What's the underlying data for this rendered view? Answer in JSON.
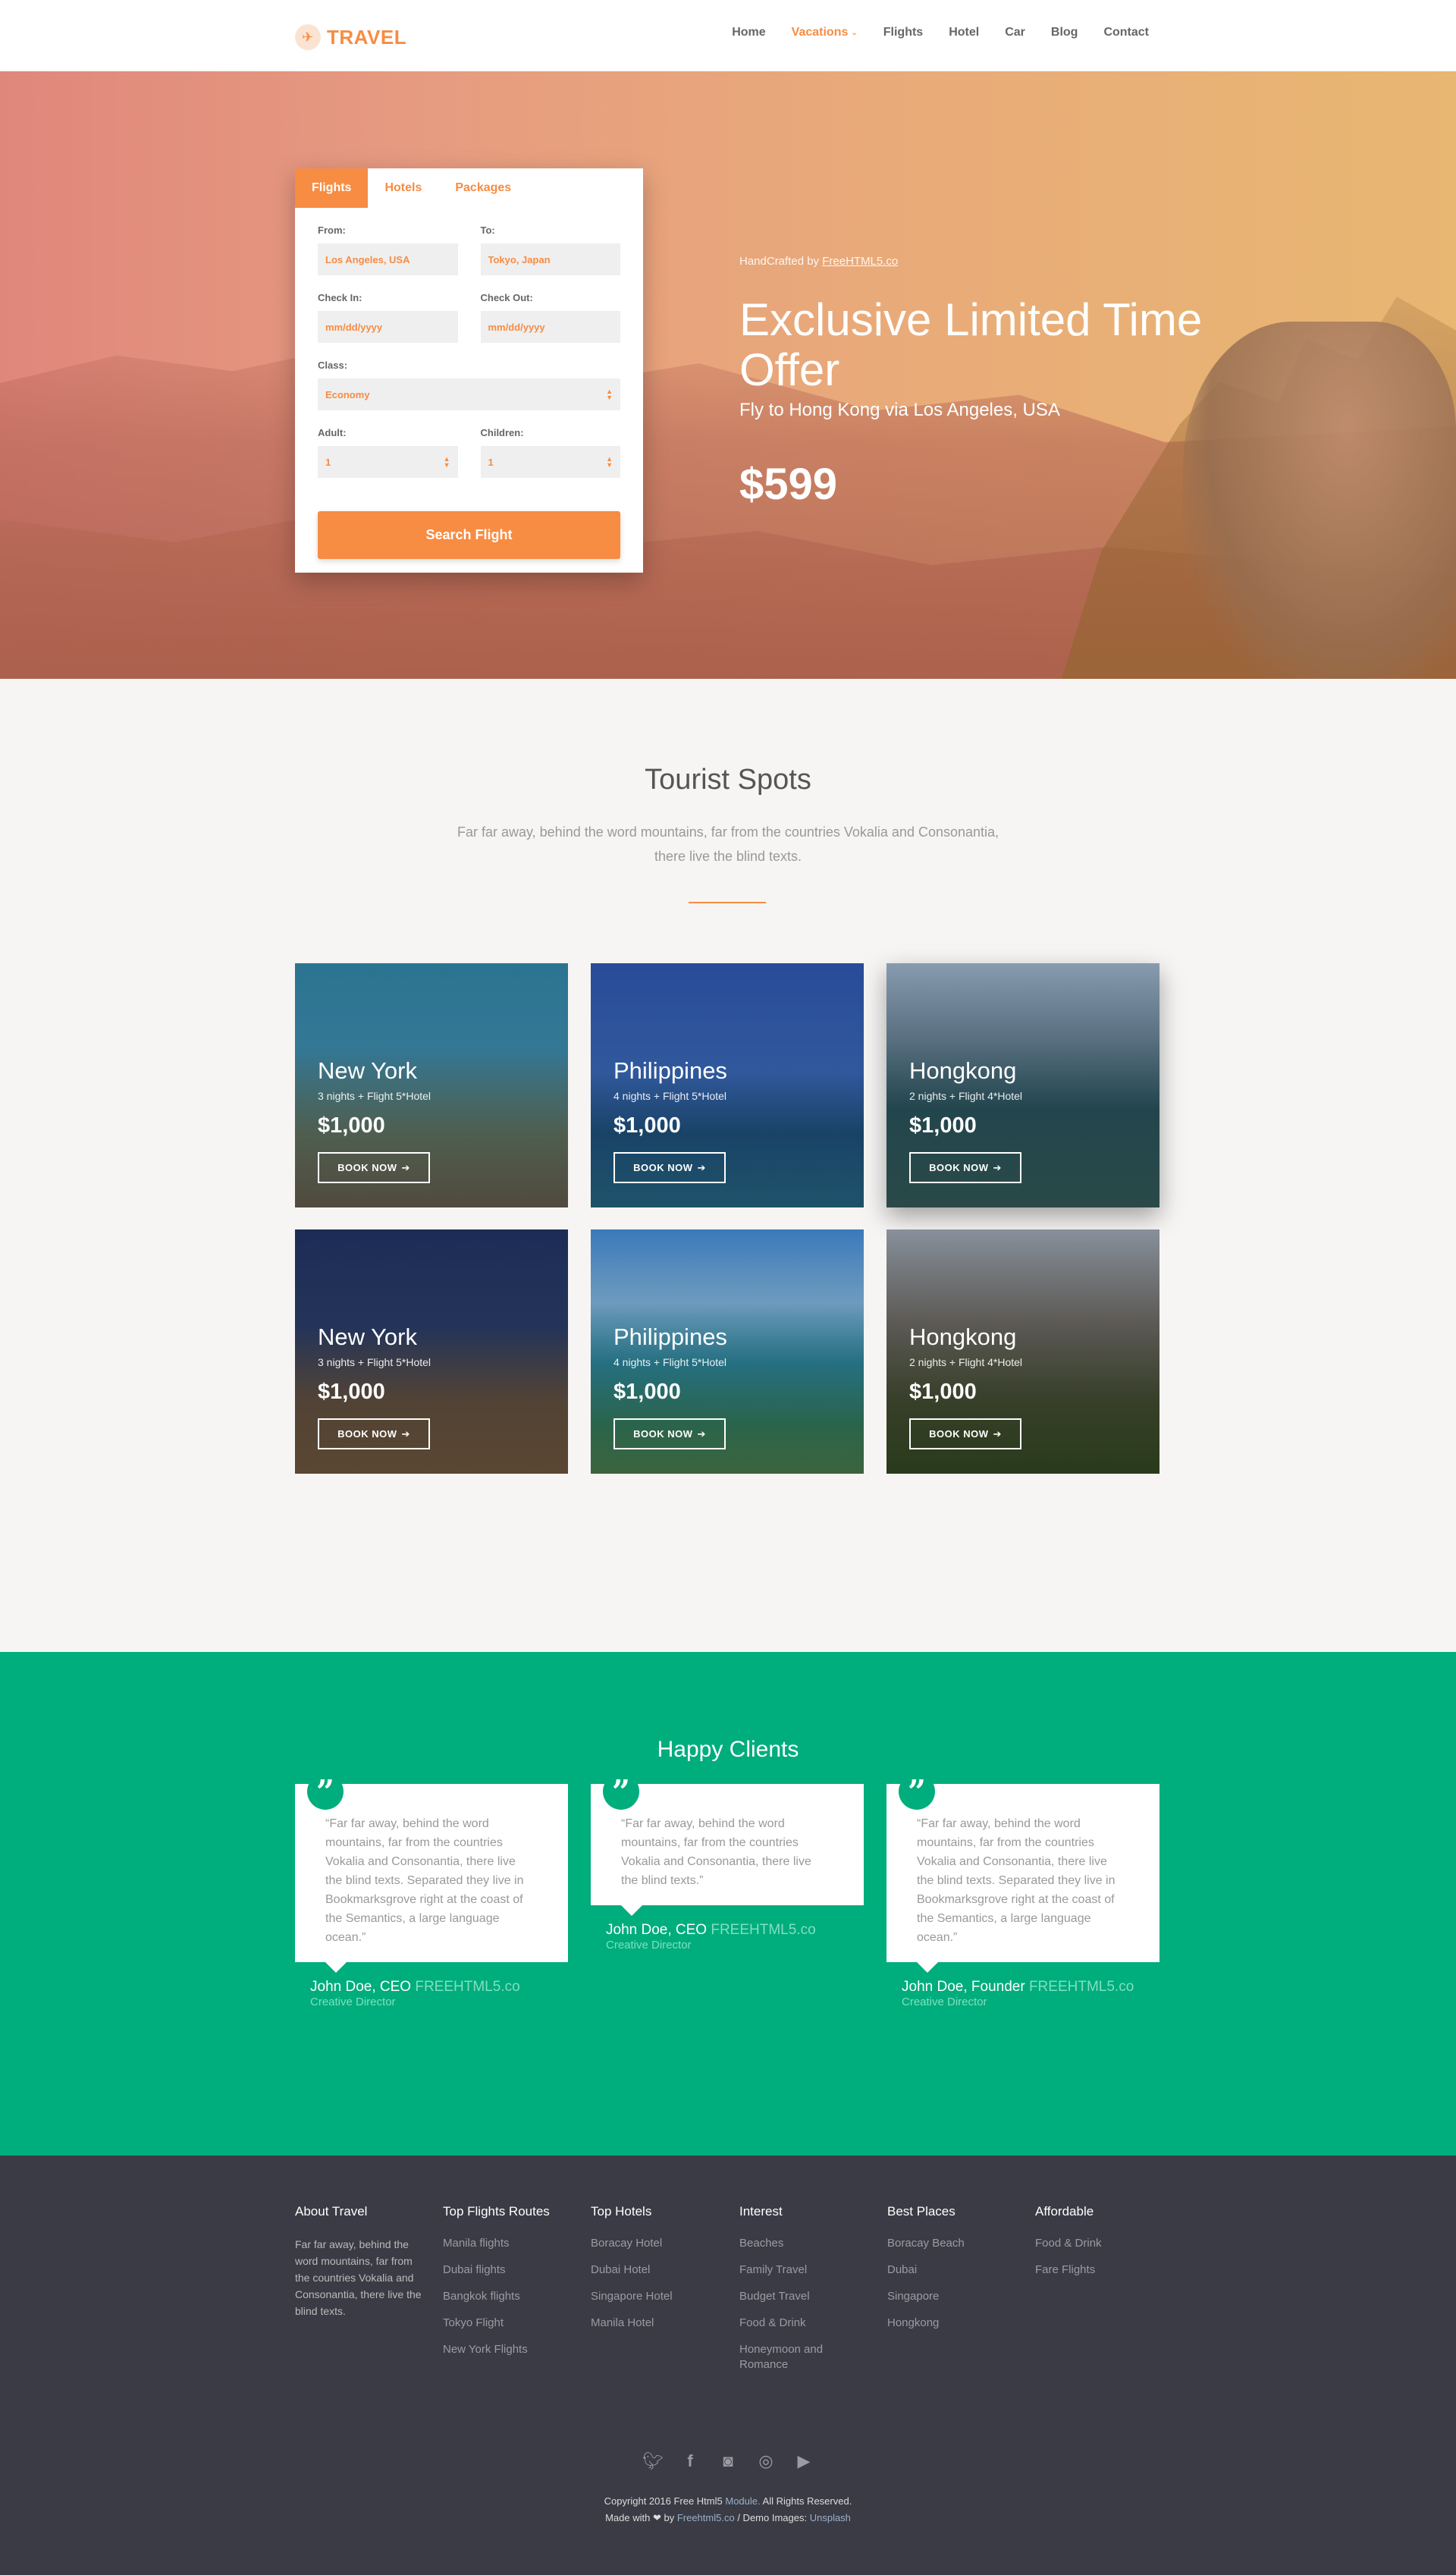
{
  "nav": {
    "logo": "TRAVEL",
    "items": [
      "Home",
      "Vacations",
      "Flights",
      "Hotel",
      "Car",
      "Blog",
      "Contact"
    ]
  },
  "search": {
    "tabs": [
      "Flights",
      "Hotels",
      "Packages"
    ],
    "from_label": "From:",
    "from_value": "Los Angeles, USA",
    "to_label": "To:",
    "to_value": "Tokyo, Japan",
    "checkin_label": "Check In:",
    "checkin_value": "mm/dd/yyyy",
    "checkout_label": "Check Out:",
    "checkout_value": "mm/dd/yyyy",
    "class_label": "Class:",
    "class_value": "Economy",
    "adult_label": "Adult:",
    "adult_value": "1",
    "children_label": "Children:",
    "children_value": "1",
    "button": "Search Flight"
  },
  "offer": {
    "handcrafted": "HandCrafted by",
    "handcrafted_link": "FreeHTML5.co",
    "title": "Exclusive Limited Time Offer",
    "subtitle": "Fly to Hong Kong via Los Angeles, USA",
    "price": "$599"
  },
  "tourist": {
    "title": "Tourist Spots",
    "lead": "Far far away, behind the word mountains, far from the countries Vokalia and Consonantia, there live the blind texts.",
    "cards": [
      {
        "city": "New York",
        "info": "3 nights + Flight 5*Hotel",
        "price": "$1,000",
        "button": "BOOK NOW"
      },
      {
        "city": "Philippines",
        "info": "4 nights + Flight 5*Hotel",
        "price": "$1,000",
        "button": "BOOK NOW"
      },
      {
        "city": "Hongkong",
        "info": "2 nights + Flight 4*Hotel",
        "price": "$1,000",
        "button": "BOOK NOW"
      },
      {
        "city": "New York",
        "info": "3 nights + Flight 5*Hotel",
        "price": "$1,000",
        "button": "BOOK NOW"
      },
      {
        "city": "Philippines",
        "info": "4 nights + Flight 5*Hotel",
        "price": "$1,000",
        "button": "BOOK NOW"
      },
      {
        "city": "Hongkong",
        "info": "2 nights + Flight 4*Hotel",
        "price": "$1,000",
        "button": "BOOK NOW"
      }
    ]
  },
  "clients": {
    "title": "Happy Clients",
    "testimonials": [
      {
        "quote": "“Far far away, behind the word mountains, far from the countries Vokalia and Consonantia, there live the blind texts. Separated they live in Bookmarksgrove right at the coast of the Semantics, a large language ocean.”",
        "name": "John Doe, CEO",
        "brand": "FREEHTML5.co",
        "role": "Creative Director"
      },
      {
        "quote": "“Far far away, behind the word mountains, far from the countries Vokalia and Consonantia, there live the blind texts.”",
        "name": "John Doe, CEO",
        "brand": "FREEHTML5.co",
        "role": "Creative Director"
      },
      {
        "quote": "“Far far away, behind the word mountains, far from the countries Vokalia and Consonantia, there live the blind texts. Separated they live in Bookmarksgrove right at the coast of the Semantics, a large language ocean.”",
        "name": "John Doe, Founder",
        "brand": "FREEHTML5.co",
        "role": "Creative Director"
      }
    ]
  },
  "footer": {
    "about_title": "About Travel",
    "about_text": "Far far away, behind the word mountains, far from the countries Vokalia and Consonantia, there live the blind texts.",
    "columns": [
      {
        "title": "Top Flights Routes",
        "links": [
          "Manila flights",
          "Dubai flights",
          "Bangkok flights",
          "Tokyo Flight",
          "New York Flights"
        ]
      },
      {
        "title": "Top Hotels",
        "links": [
          "Boracay Hotel",
          "Dubai Hotel",
          "Singapore Hotel",
          "Manila Hotel"
        ]
      },
      {
        "title": "Interest",
        "links": [
          "Beaches",
          "Family Travel",
          "Budget Travel",
          "Food & Drink",
          "Honeymoon and Romance"
        ]
      },
      {
        "title": "Best Places",
        "links": [
          "Boracay Beach",
          "Dubai",
          "Singapore",
          "Hongkong"
        ]
      },
      {
        "title": "Affordable",
        "links": [
          "Food & Drink",
          "Fare Flights"
        ]
      }
    ],
    "social_icons": [
      "twitter-icon",
      "facebook-icon",
      "instagram-icon",
      "dribbble-icon",
      "youtube-icon"
    ],
    "copyright_1": "Copyright 2016 Free Html5",
    "copyright_module": "Module.",
    "copyright_2": "All Rights Reserved.",
    "made_with": "Made with",
    "made_by": "by",
    "made_link": "Freehtml5.co",
    "demo_images": "/ Demo Images:",
    "demo_link": "Unsplash"
  },
  "colors": {
    "accent": "#f78c43",
    "green": "#00ad7c",
    "footer": "#3a3b44"
  }
}
